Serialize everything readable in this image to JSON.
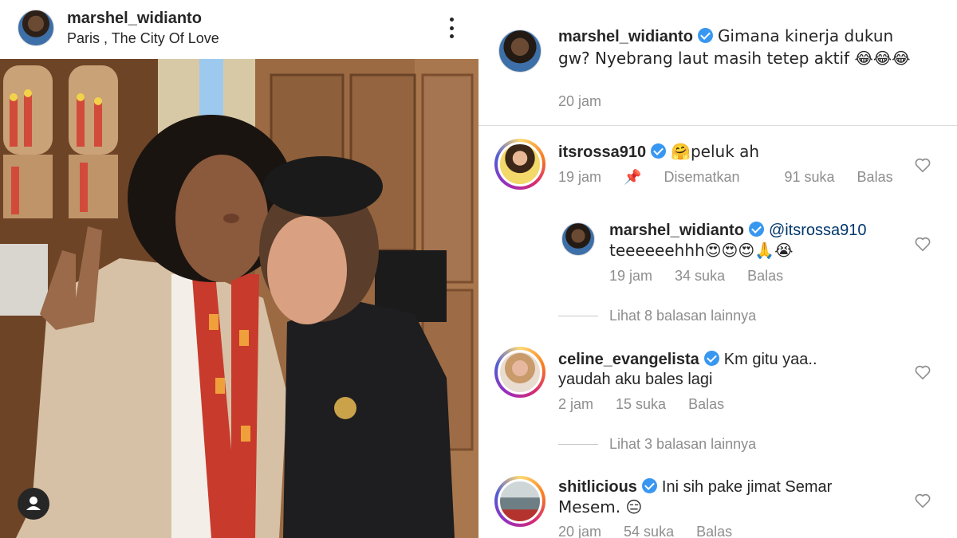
{
  "post": {
    "username": "marshel_widianto",
    "location": "Paris , The City Of Love",
    "more_icon": "more-vertical-icon",
    "tag_icon": "user-tag-icon"
  },
  "caption": {
    "username": "marshel_widianto",
    "text": "Gimana kinerja dukun gw? Nyebrang laut masih tetep aktif 😂😂😂",
    "time": "20 jam"
  },
  "comments": [
    {
      "username": "itsrossa910",
      "text": "🤗peluk ah",
      "time": "19 jam",
      "pinned": "Disematkan",
      "likes": "91 suka",
      "reply": "Balas"
    },
    {
      "username": "marshel_widianto",
      "mention": "@itsrossa910",
      "text": "teeeeeehhh😍😍😍🙏😭",
      "time": "19 jam",
      "likes": "34 suka",
      "reply": "Balas"
    },
    {
      "view_more": "Lihat 8 balasan lainnya"
    },
    {
      "username": "celine_evangelista",
      "text_line1": "Km gitu yaa..",
      "text_line2": "yaudah aku bales lagi",
      "time": "2 jam",
      "likes": "15 suka",
      "reply": "Balas"
    },
    {
      "view_more": "Lihat 3 balasan lainnya"
    },
    {
      "username": "shitlicious",
      "text_line1": "Ini sih pake jimat Semar",
      "text_line2": "Mesem. 😑",
      "time": "20 jam",
      "likes": "54 suka",
      "reply": "Balas"
    }
  ],
  "colors": {
    "verified": "#3897f0",
    "muted": "#8e8e8e",
    "text": "#262626",
    "mention": "#00376b"
  }
}
